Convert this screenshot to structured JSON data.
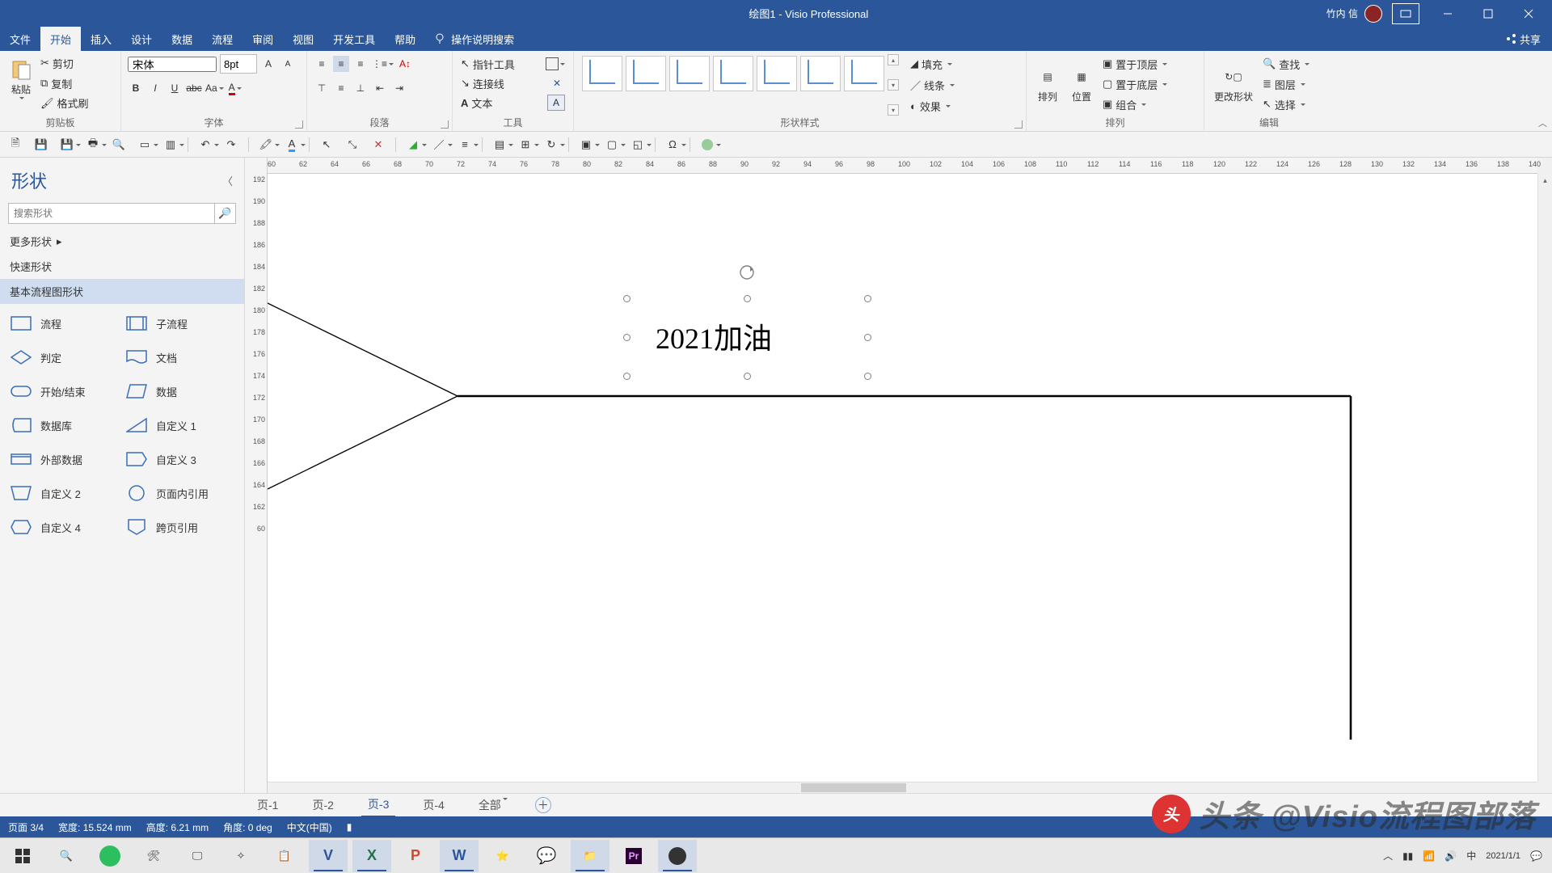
{
  "titlebar": {
    "title": "绘图1  -  Visio Professional",
    "username": "竹内 信"
  },
  "tabs": {
    "file": "文件",
    "home": "开始",
    "insert": "插入",
    "design": "设计",
    "data": "数据",
    "process": "流程",
    "review": "审阅",
    "view": "视图",
    "devtools": "开发工具",
    "help": "帮助",
    "tellme": "操作说明搜索",
    "share": "共享"
  },
  "ribbon": {
    "clipboard": {
      "paste": "粘贴",
      "cut": "剪切",
      "copy": "复制",
      "formatpainter": "格式刷",
      "name": "剪贴板"
    },
    "font": {
      "family": "宋体",
      "size": "8pt",
      "name": "字体"
    },
    "paragraph": {
      "name": "段落"
    },
    "tools": {
      "pointer": "指针工具",
      "connector": "连接线",
      "text": "文本",
      "name": "工具"
    },
    "shapestyles": {
      "fill": "填充",
      "line": "线条",
      "effects": "效果",
      "name": "形状样式"
    },
    "arrange": {
      "align": "排列",
      "position": "位置",
      "front": "置于顶层",
      "back": "置于底层",
      "group": "组合",
      "name": "排列"
    },
    "edit": {
      "changeshape": "更改形状",
      "find": "查找",
      "layers": "图层",
      "select": "选择",
      "name": "编辑"
    }
  },
  "sidepanel": {
    "title": "形状",
    "search_placeholder": "搜索形状",
    "more": "更多形状",
    "quick": "快速形状",
    "category": "基本流程图形状",
    "shapes": {
      "process": "流程",
      "subprocess": "子流程",
      "decision": "判定",
      "document": "文档",
      "startend": "开始/结束",
      "data": "数据",
      "database": "数据库",
      "custom1": "自定义 1",
      "extdata": "外部数据",
      "custom3": "自定义 3",
      "custom2": "自定义 2",
      "onpage": "页面内引用",
      "custom4": "自定义 4",
      "offpage": "跨页引用"
    }
  },
  "canvas": {
    "text": "2021加油"
  },
  "ruler_h": [
    "60",
    "62",
    "64",
    "66",
    "68",
    "70",
    "72",
    "74",
    "76",
    "78",
    "80",
    "82",
    "84",
    "86",
    "88",
    "90",
    "92",
    "94",
    "96",
    "98",
    "100",
    "102",
    "104",
    "106",
    "108",
    "110",
    "112",
    "114",
    "116",
    "118",
    "120",
    "122",
    "124",
    "126",
    "128",
    "130",
    "132",
    "134",
    "136",
    "138",
    "140"
  ],
  "ruler_v": [
    "192",
    "190",
    "188",
    "186",
    "184",
    "182",
    "180",
    "178",
    "176",
    "174",
    "172",
    "170",
    "168",
    "166",
    "164",
    "162",
    "60"
  ],
  "pagetabs": {
    "p1": "页-1",
    "p2": "页-2",
    "p3": "页-3",
    "p4": "页-4",
    "all": "全部"
  },
  "statusbar": {
    "page": "页面 3/4",
    "width": "宽度: 15.524 mm",
    "height": "高度: 6.21 mm",
    "angle": "角度: 0 deg",
    "lang": "中文(中国)"
  },
  "watermark": {
    "text": "头条 @Visio流程图部落"
  },
  "tray": {
    "date": "2021/1/1"
  }
}
